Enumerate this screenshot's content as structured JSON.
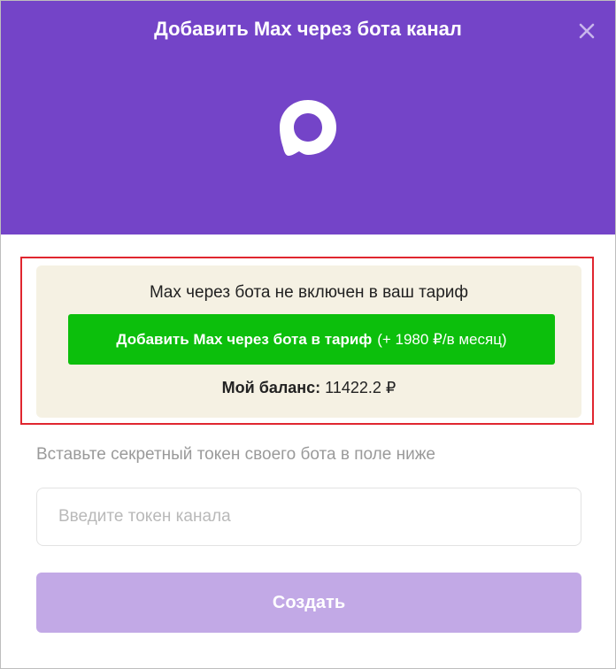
{
  "modal": {
    "title": "Добавить Max через бота канал"
  },
  "promo": {
    "message": "Max через бота не включен в ваш тариф",
    "button_label": "Добавить Max через бота в тариф",
    "button_price": "(+ 1980 ₽/в месяц)",
    "balance_label": "Мой баланс:",
    "balance_value": "11422.2 ₽"
  },
  "form": {
    "hint": "Вставьте секретный токен своего бота в поле ниже",
    "token_placeholder": "Введите токен канала",
    "token_value": "",
    "submit_label": "Создать"
  },
  "colors": {
    "header": "#7444c8",
    "promo_bg": "#f5f1e3",
    "promo_button": "#0cbf0c",
    "highlight_outline": "#e0262f",
    "submit_disabled": "#c2a9e6"
  },
  "icons": {
    "close": "close-icon",
    "logo": "max-logo-icon"
  }
}
